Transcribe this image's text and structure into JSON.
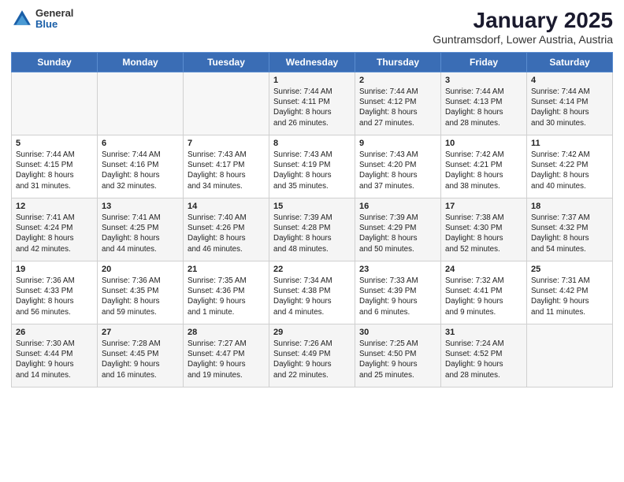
{
  "header": {
    "logo_general": "General",
    "logo_blue": "Blue",
    "title": "January 2025",
    "subtitle": "Guntramsdorf, Lower Austria, Austria"
  },
  "days_of_week": [
    "Sunday",
    "Monday",
    "Tuesday",
    "Wednesday",
    "Thursday",
    "Friday",
    "Saturday"
  ],
  "weeks": [
    [
      {
        "day": "",
        "info": ""
      },
      {
        "day": "",
        "info": ""
      },
      {
        "day": "",
        "info": ""
      },
      {
        "day": "1",
        "info": "Sunrise: 7:44 AM\nSunset: 4:11 PM\nDaylight: 8 hours\nand 26 minutes."
      },
      {
        "day": "2",
        "info": "Sunrise: 7:44 AM\nSunset: 4:12 PM\nDaylight: 8 hours\nand 27 minutes."
      },
      {
        "day": "3",
        "info": "Sunrise: 7:44 AM\nSunset: 4:13 PM\nDaylight: 8 hours\nand 28 minutes."
      },
      {
        "day": "4",
        "info": "Sunrise: 7:44 AM\nSunset: 4:14 PM\nDaylight: 8 hours\nand 30 minutes."
      }
    ],
    [
      {
        "day": "5",
        "info": "Sunrise: 7:44 AM\nSunset: 4:15 PM\nDaylight: 8 hours\nand 31 minutes."
      },
      {
        "day": "6",
        "info": "Sunrise: 7:44 AM\nSunset: 4:16 PM\nDaylight: 8 hours\nand 32 minutes."
      },
      {
        "day": "7",
        "info": "Sunrise: 7:43 AM\nSunset: 4:17 PM\nDaylight: 8 hours\nand 34 minutes."
      },
      {
        "day": "8",
        "info": "Sunrise: 7:43 AM\nSunset: 4:19 PM\nDaylight: 8 hours\nand 35 minutes."
      },
      {
        "day": "9",
        "info": "Sunrise: 7:43 AM\nSunset: 4:20 PM\nDaylight: 8 hours\nand 37 minutes."
      },
      {
        "day": "10",
        "info": "Sunrise: 7:42 AM\nSunset: 4:21 PM\nDaylight: 8 hours\nand 38 minutes."
      },
      {
        "day": "11",
        "info": "Sunrise: 7:42 AM\nSunset: 4:22 PM\nDaylight: 8 hours\nand 40 minutes."
      }
    ],
    [
      {
        "day": "12",
        "info": "Sunrise: 7:41 AM\nSunset: 4:24 PM\nDaylight: 8 hours\nand 42 minutes."
      },
      {
        "day": "13",
        "info": "Sunrise: 7:41 AM\nSunset: 4:25 PM\nDaylight: 8 hours\nand 44 minutes."
      },
      {
        "day": "14",
        "info": "Sunrise: 7:40 AM\nSunset: 4:26 PM\nDaylight: 8 hours\nand 46 minutes."
      },
      {
        "day": "15",
        "info": "Sunrise: 7:39 AM\nSunset: 4:28 PM\nDaylight: 8 hours\nand 48 minutes."
      },
      {
        "day": "16",
        "info": "Sunrise: 7:39 AM\nSunset: 4:29 PM\nDaylight: 8 hours\nand 50 minutes."
      },
      {
        "day": "17",
        "info": "Sunrise: 7:38 AM\nSunset: 4:30 PM\nDaylight: 8 hours\nand 52 minutes."
      },
      {
        "day": "18",
        "info": "Sunrise: 7:37 AM\nSunset: 4:32 PM\nDaylight: 8 hours\nand 54 minutes."
      }
    ],
    [
      {
        "day": "19",
        "info": "Sunrise: 7:36 AM\nSunset: 4:33 PM\nDaylight: 8 hours\nand 56 minutes."
      },
      {
        "day": "20",
        "info": "Sunrise: 7:36 AM\nSunset: 4:35 PM\nDaylight: 8 hours\nand 59 minutes."
      },
      {
        "day": "21",
        "info": "Sunrise: 7:35 AM\nSunset: 4:36 PM\nDaylight: 9 hours\nand 1 minute."
      },
      {
        "day": "22",
        "info": "Sunrise: 7:34 AM\nSunset: 4:38 PM\nDaylight: 9 hours\nand 4 minutes."
      },
      {
        "day": "23",
        "info": "Sunrise: 7:33 AM\nSunset: 4:39 PM\nDaylight: 9 hours\nand 6 minutes."
      },
      {
        "day": "24",
        "info": "Sunrise: 7:32 AM\nSunset: 4:41 PM\nDaylight: 9 hours\nand 9 minutes."
      },
      {
        "day": "25",
        "info": "Sunrise: 7:31 AM\nSunset: 4:42 PM\nDaylight: 9 hours\nand 11 minutes."
      }
    ],
    [
      {
        "day": "26",
        "info": "Sunrise: 7:30 AM\nSunset: 4:44 PM\nDaylight: 9 hours\nand 14 minutes."
      },
      {
        "day": "27",
        "info": "Sunrise: 7:28 AM\nSunset: 4:45 PM\nDaylight: 9 hours\nand 16 minutes."
      },
      {
        "day": "28",
        "info": "Sunrise: 7:27 AM\nSunset: 4:47 PM\nDaylight: 9 hours\nand 19 minutes."
      },
      {
        "day": "29",
        "info": "Sunrise: 7:26 AM\nSunset: 4:49 PM\nDaylight: 9 hours\nand 22 minutes."
      },
      {
        "day": "30",
        "info": "Sunrise: 7:25 AM\nSunset: 4:50 PM\nDaylight: 9 hours\nand 25 minutes."
      },
      {
        "day": "31",
        "info": "Sunrise: 7:24 AM\nSunset: 4:52 PM\nDaylight: 9 hours\nand 28 minutes."
      },
      {
        "day": "",
        "info": ""
      }
    ]
  ]
}
